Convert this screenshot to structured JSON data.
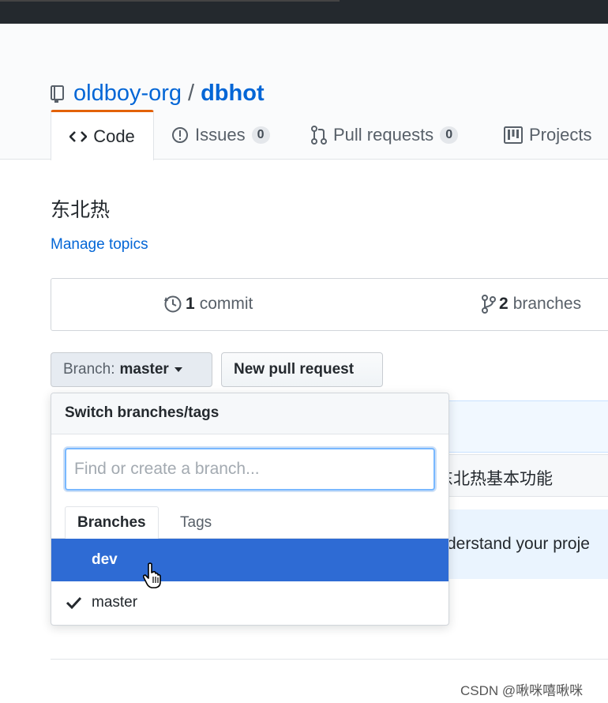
{
  "repo": {
    "owner": "oldboy-org",
    "separator": "/",
    "name": "dbhot"
  },
  "tabs": [
    {
      "label": "Code"
    },
    {
      "label": "Issues",
      "count": "0"
    },
    {
      "label": "Pull requests",
      "count": "0"
    },
    {
      "label": "Projects"
    }
  ],
  "description": "东北热",
  "manage_topics": "Manage topics",
  "stats": {
    "commits_num": "1",
    "commits_label": "commit",
    "branches_num": "2",
    "branches_label": "branches"
  },
  "branch_button": {
    "prefix": "Branch:",
    "value": "master"
  },
  "new_pr_button": "New pull request",
  "dropdown": {
    "title": "Switch branches/tags",
    "placeholder": "Find or create a branch...",
    "tab_branches": "Branches",
    "tab_tags": "Tags",
    "items": [
      {
        "label": "dev",
        "selected": false
      },
      {
        "label": "master",
        "selected": true
      }
    ]
  },
  "background": {
    "commit_message": "东北热基本功能",
    "readme_fragment": "derstand your proje"
  },
  "watermark": "CSDN @啾咪嘻啾咪",
  "colors": {
    "link": "#0366d6",
    "tab_accent": "#e36209",
    "hover_row": "#2e6bd4",
    "topbar": "#24292e"
  }
}
